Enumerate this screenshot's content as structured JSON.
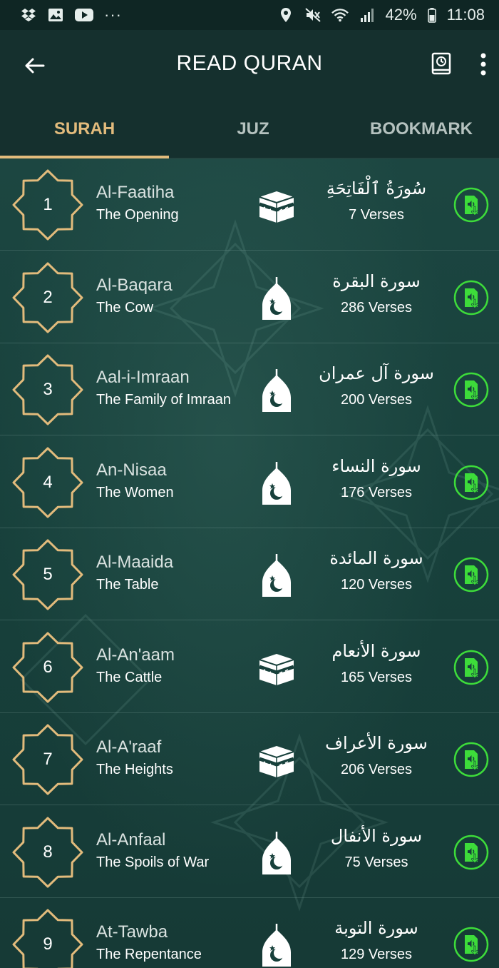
{
  "status_bar": {
    "battery": "42%",
    "time": "11:08",
    "dots": "···"
  },
  "app_bar": {
    "title": "READ QURAN"
  },
  "tabs": [
    {
      "label": "SURAH",
      "active": true
    },
    {
      "label": "JUZ",
      "active": false
    },
    {
      "label": "BOOKMARK",
      "active": false
    }
  ],
  "colors": {
    "accent_gold": "#e2bb7c",
    "download_green": "#3ddc3a",
    "background": "#17403b"
  },
  "surahs": [
    {
      "number": "1",
      "name": "Al-Faatiha",
      "meaning": "The Opening",
      "arabic": "سُورَةُ ٱلْفَاتِحَةِ",
      "verses": "7 Verses",
      "place_icon": "kaaba-icon"
    },
    {
      "number": "2",
      "name": "Al-Baqara",
      "meaning": "The Cow",
      "arabic": "سورة البقرة",
      "verses": "286 Verses",
      "place_icon": "mosque-dome-icon"
    },
    {
      "number": "3",
      "name": "Aal-i-Imraan",
      "meaning": "The Family of Imraan",
      "arabic": "سورة آل عمران",
      "verses": "200 Verses",
      "place_icon": "mosque-dome-icon"
    },
    {
      "number": "4",
      "name": "An-Nisaa",
      "meaning": "The Women",
      "arabic": "سورة النساء",
      "verses": "176 Verses",
      "place_icon": "mosque-dome-icon"
    },
    {
      "number": "5",
      "name": "Al-Maaida",
      "meaning": "The Table",
      "arabic": "سورة المائدة",
      "verses": "120 Verses",
      "place_icon": "mosque-dome-icon"
    },
    {
      "number": "6",
      "name": "Al-An'aam",
      "meaning": "The Cattle",
      "arabic": "سورة الأنعام",
      "verses": "165 Verses",
      "place_icon": "kaaba-icon"
    },
    {
      "number": "7",
      "name": "Al-A'raaf",
      "meaning": "The Heights",
      "arabic": "سورة الأعراف",
      "verses": "206 Verses",
      "place_icon": "kaaba-icon"
    },
    {
      "number": "8",
      "name": "Al-Anfaal",
      "meaning": "The Spoils of War",
      "arabic": "سورة الأنفال",
      "verses": "75 Verses",
      "place_icon": "mosque-dome-icon"
    },
    {
      "number": "9",
      "name": "At-Tawba",
      "meaning": "The Repentance",
      "arabic": "سورة التوبة",
      "verses": "129 Verses",
      "place_icon": "mosque-dome-icon"
    }
  ]
}
